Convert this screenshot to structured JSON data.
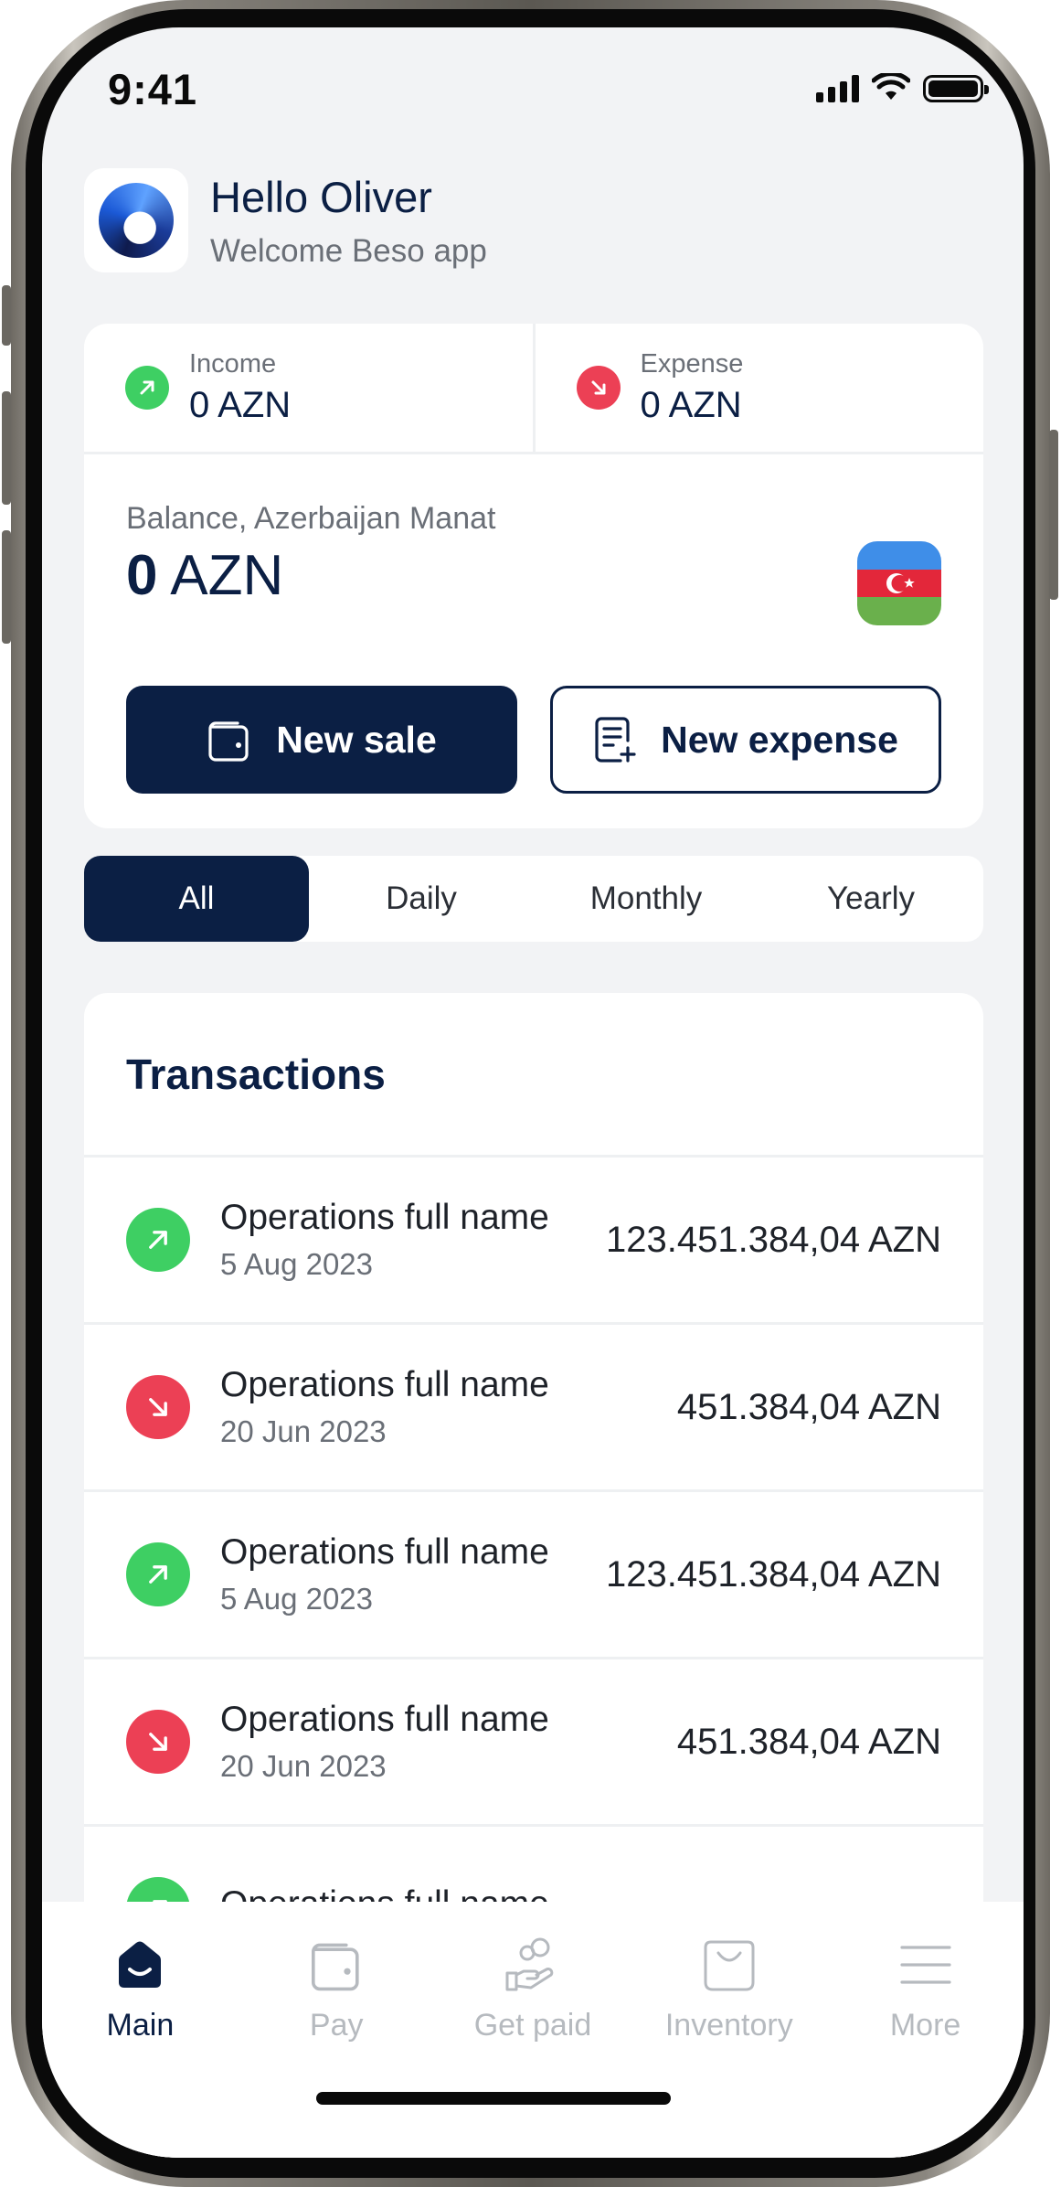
{
  "status_bar": {
    "time": "9:41"
  },
  "header": {
    "greeting": "Hello Oliver",
    "subtitle": "Welcome Beso app"
  },
  "summary": {
    "income": {
      "label": "Income",
      "value": "0 AZN"
    },
    "expense": {
      "label": "Expense",
      "value": "0 AZN"
    }
  },
  "balance": {
    "label": "Balance, Azerbaijan Manat",
    "amount": "0",
    "currency": "AZN"
  },
  "actions": {
    "new_sale": "New sale",
    "new_expense": "New expense"
  },
  "filters": {
    "items": [
      "All",
      "Daily",
      "Monthly",
      "Yearly"
    ],
    "selected": "All"
  },
  "transactions": {
    "title": "Transactions",
    "items": [
      {
        "name": "Operations full name",
        "date": "5 Aug 2023",
        "amount": "123.451.384,04 AZN",
        "type": "income"
      },
      {
        "name": "Operations full name",
        "date": "20 Jun 2023",
        "amount": "451.384,04 AZN",
        "type": "expense"
      },
      {
        "name": "Operations full name",
        "date": "5 Aug 2023",
        "amount": "123.451.384,04 AZN",
        "type": "income"
      },
      {
        "name": "Operations full name",
        "date": "20 Jun 2023",
        "amount": "451.384,04 AZN",
        "type": "expense"
      },
      {
        "name": "Operations full name",
        "date": "",
        "amount": "",
        "type": "income"
      }
    ]
  },
  "bottom_nav": {
    "items": [
      {
        "label": "Main",
        "icon": "home-icon",
        "active": true
      },
      {
        "label": "Pay",
        "icon": "wallet-icon",
        "active": false
      },
      {
        "label": "Get paid",
        "icon": "hand-coins-icon",
        "active": false
      },
      {
        "label": "Inventory",
        "icon": "bag-icon",
        "active": false
      },
      {
        "label": "More",
        "icon": "menu-icon",
        "active": false
      }
    ]
  },
  "colors": {
    "primary": "#0b1f44",
    "income": "#3ecf63",
    "expense": "#ec4055",
    "background": "#f2f3f5"
  }
}
